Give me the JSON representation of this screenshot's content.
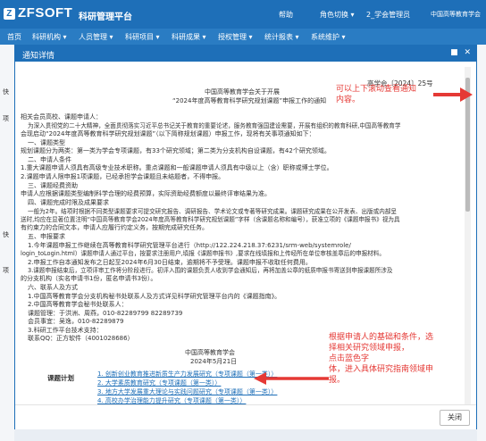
{
  "app": {
    "logo": "ZFSOFT",
    "logo_mark": "Z",
    "title": "科研管理平台"
  },
  "topbar": {
    "help": "帮助",
    "role": "角色切换",
    "user": "2_学会管理员",
    "org": "中国高等教育学会"
  },
  "nav": [
    "首页",
    "科研机构",
    "人员管理",
    "科研项目",
    "科研成果",
    "授权管理",
    "统计报表",
    "系统维护"
  ],
  "background": {
    "left_labels": [
      "快",
      "项",
      "快",
      "项"
    ]
  },
  "dialog": {
    "title": "通知详情",
    "close_label": "关闭",
    "doc": {
      "number": "高学会〔2024〕25号",
      "org_line": "中国高等教育学会关于开展",
      "title_line": "“2024年度高等教育科学研究规划课题”申报工作的通知",
      "salutation": "相关会员高校、课题申请人：",
      "para1a": "为深入贯彻党的二十大精神，全面贯彻落实习近平总书记关于教育的重要论述，服务教育强国建设需要，开展有组织的教育科研,中国高等教育学",
      "para1b": "会现启动“2024年度高等教育科学研究规划课题”（以下简称规划课题）申报工作，现将有关事项通知如下：",
      "s1": "一、课题类型",
      "s1a": "规划课题分为两类：第一类为学会专项课题，有33个研究领域；第二类为分支机构自设课题，有42个研究领域。",
      "s2": "二、申请人条件",
      "s2a": "1.重大课题申请人须具有高级专业技术职称。重点课题和一般课题申请人须具有中级以上（含）职称或博士学位。",
      "s2b": "2.课题申请人限申报1项课题，已经承担学会课题且未结题者，不得申报。",
      "s3": "三、课题经费资助",
      "s3a": "申请人应根据课题类型编制科学合理的经费预算，实际资助经费额度以最终评审结果为准。",
      "s4": "四、课题完成时限及成果要求",
      "s4a": "一般为2年。结项时根据不同类型课题要求可提交研究报告、调研报告、学术论文或专著等研究成果。课题研究成果在公开发表、出版或内部呈",
      "s4b": "送时,均应在显著位置注明“中国高等教育学会2024年度高等教育科学研究规划课题”字样（含课题名称和编号），获准立项的《课题申报书》视为具",
      "s4c": "有约束力的合同文本，申请人应履行约定义务，按期完成研究任务。",
      "s5": "五、申报要求",
      "s5a": "1.今年课题申报工作继续在高等教育科学研究管理平台进行（http://122.224.218.37:6231/srm-web/systemrole/",
      "s5b": "login_toLogin.html）课题申请人通过平台，按要求注册用户,填报《课题申报书》,要求在线填报和上传经所在单位审核盖章后的申报材料。",
      "s5c": "2.申报工作自本通知发布之日起至2024年6月30日结束，逾期将不予受理。课题申报不收取任何费用。",
      "s5d": "3.课题申报结束后，立项评审工作将分阶段进行。初评入围的课题负责人收到学会通知后，再将加盖公章的纸质申报书寄送到申报课题所涉及",
      "s5e": "的分支机构（实名申请书1份，匿名申请书3份）。",
      "s6": "六、联系人及方式",
      "s6a": "1.中国高等教育学会分支机构秘书处联系人及方式详见科学研究管理平台内的《课题指南》。",
      "s6b": "2.中国高等教育学会秘书处联系人：",
      "s6c": "课题管理：于洪洲、周燕，010-82289799 82289739",
      "s6d": "会员事宜：吴逸，010-82289879",
      "s6e": "3.科研工作平台技术支持：",
      "s6f": "联系QQ：正方软件（4001028686）",
      "sign_org": "中国高等教育学会",
      "sign_date": "2024年5月21日",
      "plan_label": "课题计划",
      "plan_items": [
        "1.    创新创业教育推进新质生产力发展研究（专项课题（第一类））",
        "2.    大学素质教育研究（专项课题（第一类））",
        "3.    地方大学发展重大理论与实践问题研究（专项课题（第一类））",
        "4.    高校办学治理能力提升研究（专项课题（第一类））"
      ]
    }
  },
  "annotations": {
    "top": "可以上下滚动查看通知\n内容。",
    "bottom": "根据申请人的基础和条件，选\n择相关研究领域申报，\n点击蓝色字\n体，进入具体研究指南领域申\n报。"
  },
  "colors": {
    "brand": "#1e6fb8",
    "annotation": "#e53935",
    "link": "#1e6fb8"
  }
}
